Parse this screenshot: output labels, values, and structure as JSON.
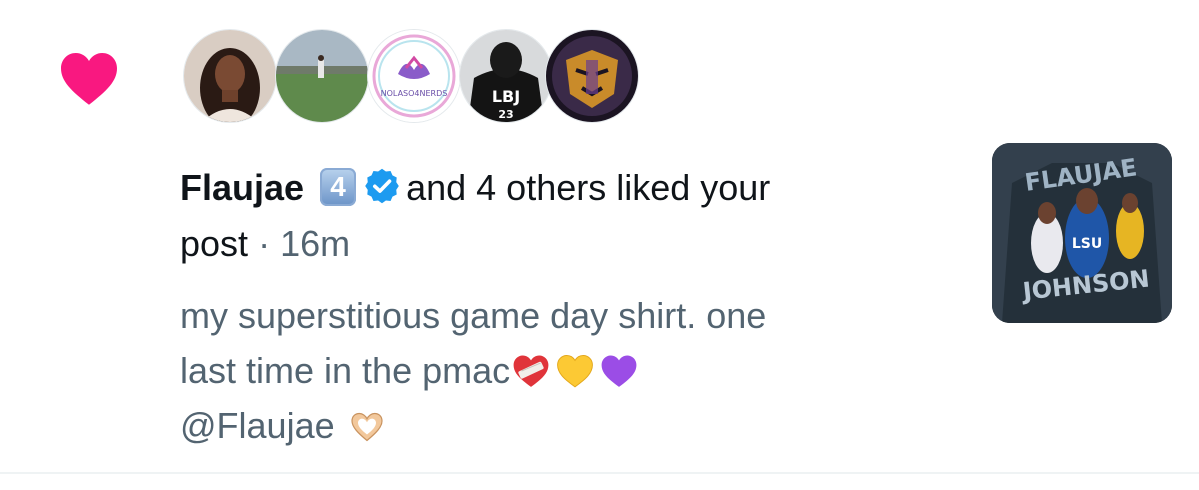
{
  "notification": {
    "type": "like",
    "actor_name": "Flaujae",
    "actor_badge": "4",
    "actor_verified": true,
    "summary": "and 4 others liked your",
    "summary_end": "post",
    "separator": "·",
    "time": "16m",
    "post_line1": "my superstitious game day shirt. one",
    "post_line2": "last time in the pmac",
    "post_emojis": [
      "mending-heart-icon",
      "yellow-heart-icon",
      "purple-heart-icon"
    ],
    "post_mention": "@Flaujae",
    "post_mention_emoji": "heart-hands-icon",
    "avatars": [
      {
        "name": "avatar-1",
        "desc": "woman portrait"
      },
      {
        "name": "avatar-2",
        "desc": "field landscape"
      },
      {
        "name": "avatar-3",
        "text": "NOLASO4NERDS"
      },
      {
        "name": "avatar-4",
        "text_top": "LBJ",
        "text_bottom": "23"
      },
      {
        "name": "avatar-5",
        "desc": "tiger logo"
      }
    ],
    "thumbnail_texts": [
      "FLAUJAE",
      "LSU",
      "JOHNSON"
    ]
  },
  "colors": {
    "like_heart": "#f91880",
    "verified": "#1d9bf0",
    "primary_text": "#0f1419",
    "secondary_text": "#536471",
    "divider": "#eff3f4"
  }
}
